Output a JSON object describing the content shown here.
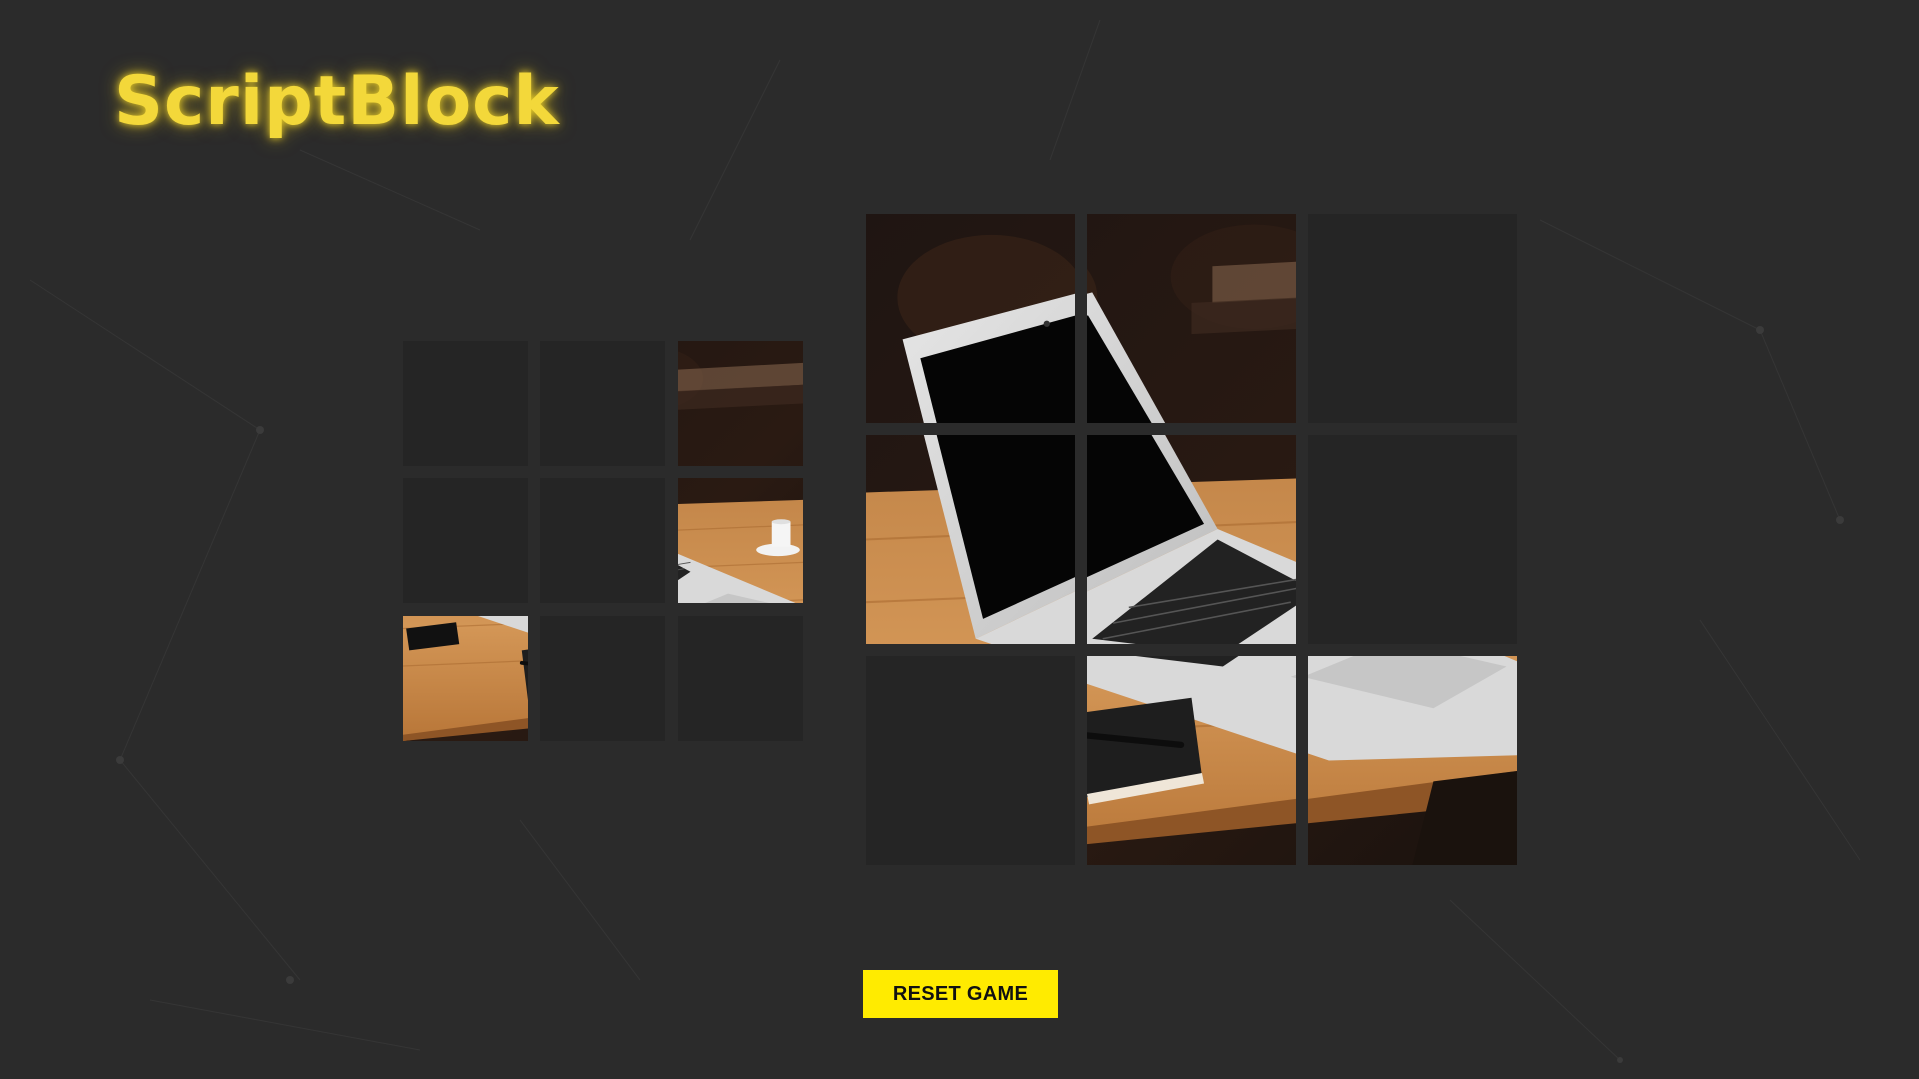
{
  "app": {
    "title": "ScriptBlock"
  },
  "colors": {
    "background": "#2b2b2b",
    "slot": "#252525",
    "accent": "#ffeb00",
    "logo": "#f3d83a"
  },
  "puzzle": {
    "image_subject": "laptop on wooden desk",
    "grid_size": 3,
    "tray": {
      "filled_slots": [
        2,
        5,
        6
      ],
      "empty_slots": [
        0,
        1,
        3,
        4,
        7,
        8
      ],
      "pieces": [
        {
          "slot": 2,
          "piece_index": 2
        },
        {
          "slot": 5,
          "piece_index": 5
        },
        {
          "slot": 6,
          "piece_index": 6
        }
      ]
    },
    "board": {
      "filled_slots": [
        0,
        1,
        3,
        4,
        7,
        8
      ],
      "empty_slots": [
        2,
        5,
        6
      ],
      "pieces": [
        {
          "slot": 0,
          "piece_index": 0
        },
        {
          "slot": 1,
          "piece_index": 1
        },
        {
          "slot": 3,
          "piece_index": 3
        },
        {
          "slot": 4,
          "piece_index": 4
        },
        {
          "slot": 7,
          "piece_index": 7
        },
        {
          "slot": 8,
          "piece_index": 8
        }
      ]
    }
  },
  "controls": {
    "reset_label": "RESET GAME"
  }
}
